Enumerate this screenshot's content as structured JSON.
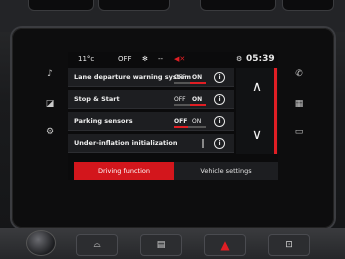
{
  "status_bar": {
    "temperature": "11°c",
    "climate_status": "OFF",
    "fan_icon": "fan-icon",
    "dash": "--",
    "mute_icon": "speaker-muted-icon",
    "time": "05:39"
  },
  "settings_rows": [
    {
      "label": "Lane departure warning system",
      "off": "OFF",
      "on": "ON",
      "state": "on"
    },
    {
      "label": "Stop & Start",
      "off": "OFF",
      "on": "ON",
      "state": "on"
    },
    {
      "label": "Parking sensors",
      "off": "OFF",
      "on": "ON",
      "state": "off"
    },
    {
      "label": "Under-inflation initialization",
      "off": "",
      "on": "",
      "state": "none"
    }
  ],
  "info_label": "i",
  "scroll": {
    "up_glyph": "∧",
    "down_glyph": "∨"
  },
  "tabs": {
    "driving_function": "Driving function",
    "vehicle_settings": "Vehicle settings"
  },
  "colors": {
    "accent": "#d3161c",
    "row_bg": "#1d1e21",
    "text": "#f0f0f0"
  },
  "hardware_icons": [
    "music-note-icon",
    "nav-icon",
    "car-settings-icon",
    "phone-icon",
    "apps-grid-icon",
    "connectivity-icon"
  ]
}
